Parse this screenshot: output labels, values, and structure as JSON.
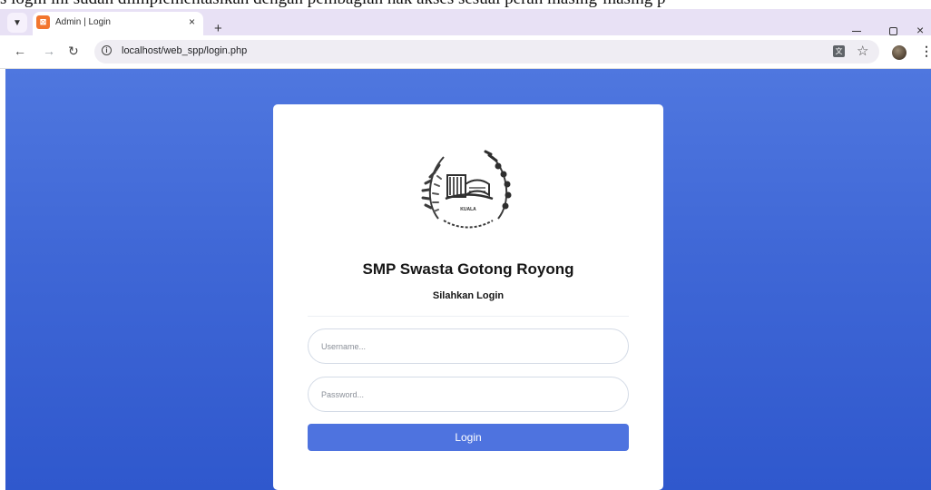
{
  "document_caption": "s login ini sudah diimplementasikan dengan pembagian hak akses sesuai peran masing-masing p",
  "browser": {
    "tab_title": "Admin | Login",
    "tab_close": "×",
    "new_tab": "+",
    "window_close": "×",
    "url": "localhost/web_spp/login.php"
  },
  "login_card": {
    "logo_text": "KUALA",
    "school_name": "SMP Swasta Gotong Royong",
    "subtitle": "Silahkan Login",
    "username": {
      "placeholder": "Username...",
      "value": ""
    },
    "password": {
      "placeholder": "Password...",
      "value": ""
    },
    "login_button": "Login"
  },
  "colors": {
    "page_gradient_top": "#4f77df",
    "page_gradient_bottom": "#2f58cd",
    "button": "#4e73df",
    "tabbar": "#e8e1f5"
  }
}
